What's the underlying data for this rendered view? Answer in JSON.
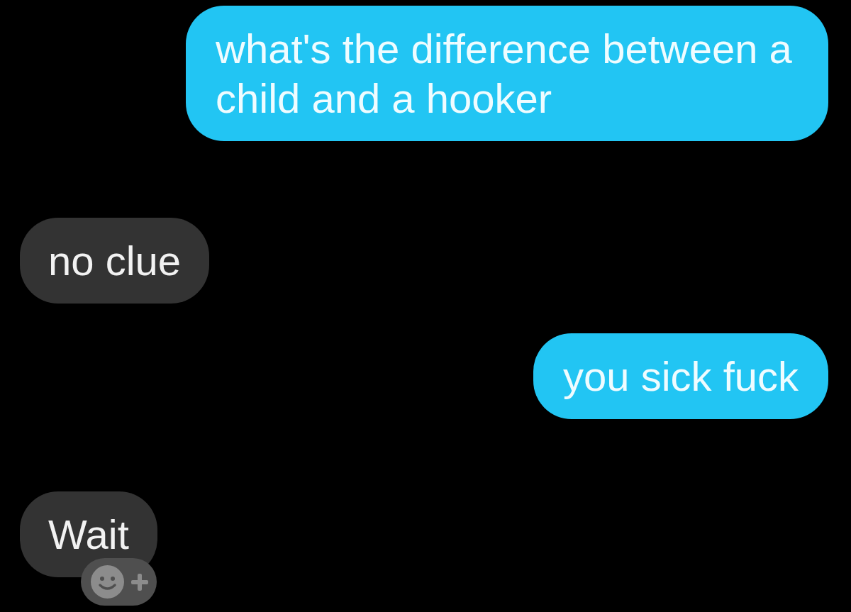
{
  "messages": [
    {
      "kind": "outgoing",
      "text": "what's the difference between a child and a hooker",
      "add_reaction_button": false
    },
    {
      "kind": "incoming",
      "text": "no clue",
      "add_reaction_button": false
    },
    {
      "kind": "outgoing",
      "text": "you sick fuck",
      "add_reaction_button": false
    },
    {
      "kind": "incoming",
      "text": "Wait",
      "add_reaction_button": true
    }
  ]
}
